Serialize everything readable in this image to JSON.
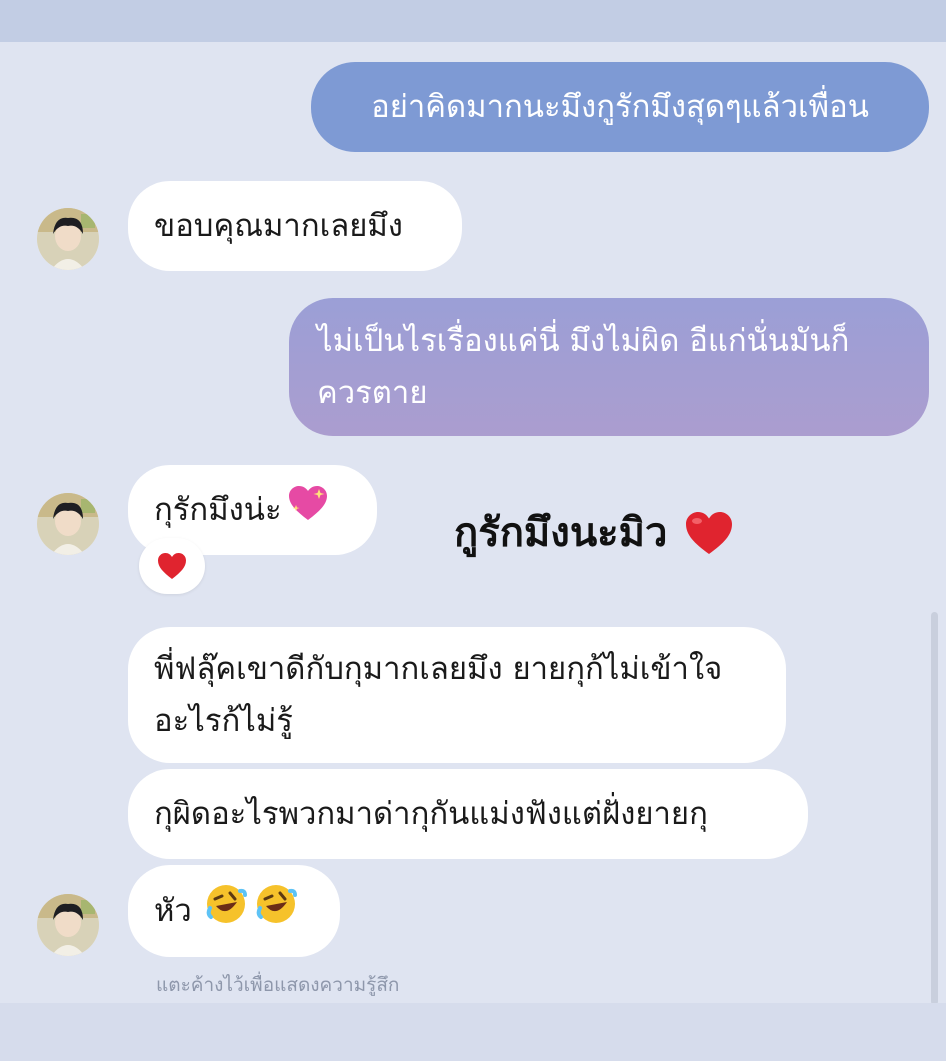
{
  "messages": {
    "out_1": "อย่าคิดมากนะมึงกูรักมึงสุดๆแล้วเพื่อน",
    "in_1": "ขอบคุณมากเลยมึง",
    "out_2": "ไม่เป็นไรเรื่องแค่นี่ มึงไม่ผิด อีแก่นั่นมันก็ควรตาย",
    "in_2": "กุรักมึงน่ะ",
    "in_3": "พี่ฟลุ๊คเขาดีกับกุมากเลยมึง ยายกุก้ไม่เข้าใจอะไรก้ไม่รู้",
    "in_4": "กุผิดอะไรพวกมาด่ากุกันแม่งฟังแต่ฝั่งยายกุ",
    "in_5": "หัว"
  },
  "reaction": {
    "emoji": "heart-icon"
  },
  "overlay_caption": "กูรักมึงนะมิว",
  "hint_text": "แตะค้างไว้เพื่อแสดงความรู้สึก",
  "colors": {
    "background": "#dfe4f1",
    "outgoing_bubble_1": "#7e9ad4",
    "outgoing_bubble_2": "#a39ed3",
    "incoming_bubble": "#ffffff",
    "heart": "#e0242f"
  }
}
